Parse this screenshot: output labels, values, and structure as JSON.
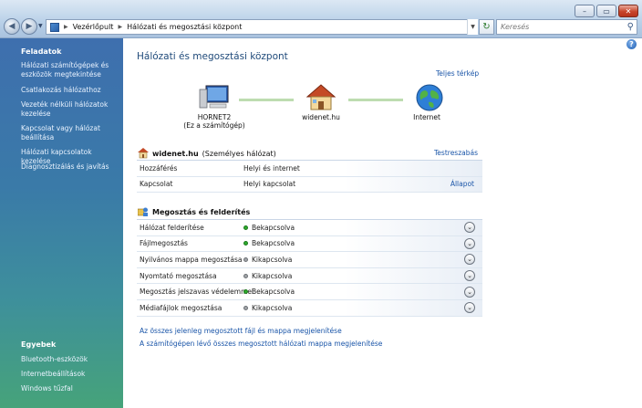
{
  "window": {
    "breadcrumb": [
      "Vezérlőpult",
      "Hálózati és megosztási központ"
    ],
    "search_placeholder": "Keresés",
    "controls": {
      "minimize": "–",
      "maximize": "▭",
      "close": "✕"
    }
  },
  "sidebar": {
    "tasks_heading": "Feladatok",
    "tasks": [
      "Hálózati számítógépek és eszközök megtekintése",
      "Csatlakozás hálózathoz",
      "Vezeték nélküli hálózatok kezelése",
      "Kapcsolat vagy hálózat beállítása",
      "Hálózati kapcsolatok kezelése",
      "Diagnosztizálás és javítás"
    ],
    "other_heading": "Egyebek",
    "other": [
      "Bluetooth-eszközök",
      "Internetbeállítások",
      "Windows tűzfal"
    ]
  },
  "main": {
    "title": "Hálózati és megosztási központ",
    "full_map_link": "Teljes térkép",
    "map": {
      "computer_name": "HORNET2",
      "computer_sub": "(Ez a számítógép)",
      "network": "widenet.hu",
      "internet": "Internet"
    },
    "network_section": {
      "name": "widenet.hu",
      "type": "(Személyes hálózat)",
      "customize_link": "Testreszabás",
      "rows": [
        {
          "label": "Hozzáférés",
          "value": "Helyi és internet"
        },
        {
          "label": "Kapcsolat",
          "value": "Helyi kapcsolat",
          "link": "Állapot"
        }
      ]
    },
    "sharing_section": {
      "heading": "Megosztás és felderítés",
      "rows": [
        {
          "label": "Hálózat felderítése",
          "value": "Bekapcsolva",
          "on": true
        },
        {
          "label": "Fájlmegosztás",
          "value": "Bekapcsolva",
          "on": true
        },
        {
          "label": "Nyilvános mappa megosztása",
          "value": "Kikapcsolva",
          "on": false
        },
        {
          "label": "Nyomtató megosztása",
          "value": "Kikapcsolva",
          "on": false
        },
        {
          "label": "Megosztás jelszavas védelemmel",
          "value": "Bekapcsolva",
          "on": true
        },
        {
          "label": "Médiafájlok megosztása",
          "value": "Kikapcsolva",
          "on": false
        }
      ]
    },
    "bottom_links": [
      "Az összes jelenleg megosztott fájl és mappa megjelenítése",
      "A számítógépen lévő összes megosztott hálózati mappa megjelenítése"
    ],
    "colors": {
      "on": "#2eaa2e",
      "off": "#a0a4a8",
      "link": "#1a55a8"
    }
  }
}
